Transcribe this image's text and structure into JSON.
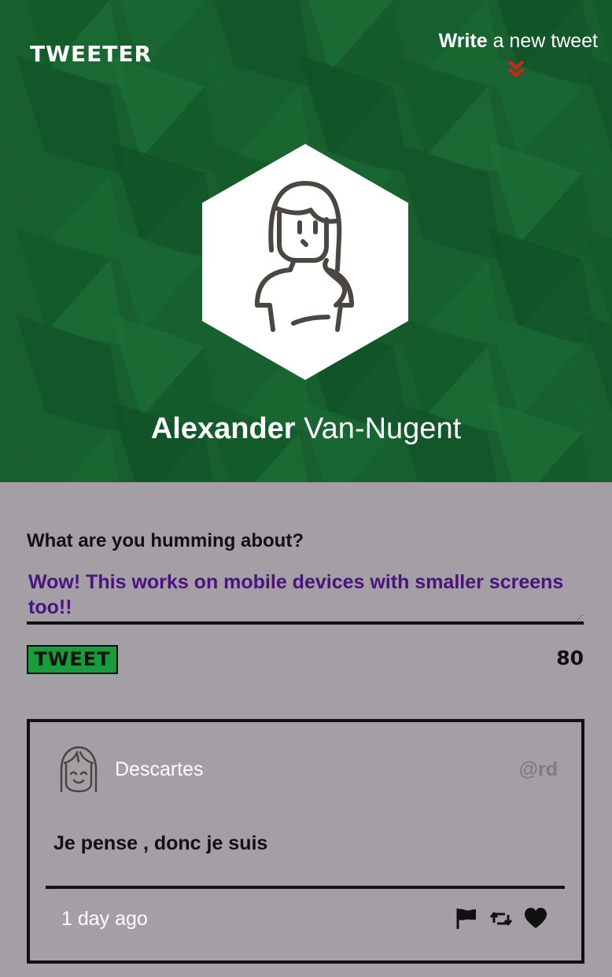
{
  "header": {
    "logo": "TWEETER",
    "write_strong": "Write",
    "write_rest": " a new tweet",
    "chevron_icon": "double-chevron-down-icon",
    "chevron_color": "#d6221b",
    "background_color": "#17602e"
  },
  "profile": {
    "first_name": "Alexander",
    "last_name": " Van-Nugent",
    "avatar_icon": "woman-avatar-icon"
  },
  "composer": {
    "label": "What are you humming about?",
    "value": "Wow! This works on mobile devices with smaller screens too!!",
    "button_label": "TWEET",
    "char_count": "80"
  },
  "tweets": [
    {
      "author": "Descartes",
      "handle": "@rd",
      "body": "Je pense , donc je suis",
      "time": "1 day ago",
      "avatar_icon": "smiling-girl-avatar-icon",
      "actions": [
        "flag-icon",
        "retweet-icon",
        "heart-icon"
      ]
    }
  ]
}
